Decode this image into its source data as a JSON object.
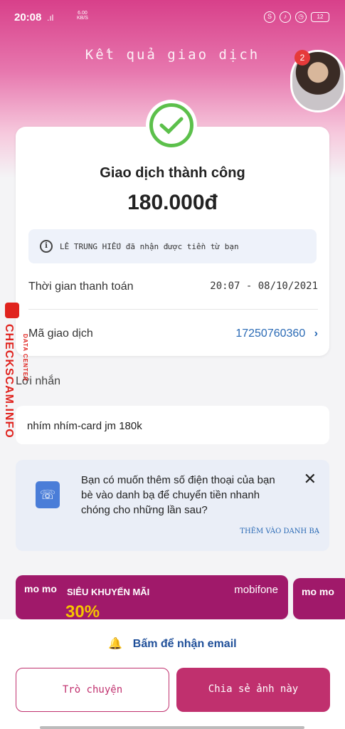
{
  "status": {
    "time": "20:08",
    "signal": ".ıl",
    "speed_top": "6.00",
    "speed_bottom": "KB/S",
    "battery": "12"
  },
  "header": {
    "title": "Kết quả giao dịch",
    "notification_count": "2"
  },
  "result": {
    "status_text": "Giao dịch thành công",
    "amount": "180.000đ",
    "info": "LÊ TRUNG HIẾU đã nhận được tiền từ bạn",
    "time_label": "Thời gian thanh toán",
    "time_value": "20:07 - 08/10/2021",
    "id_label": "Mã giao dịch",
    "id_value": "17250760360"
  },
  "message": {
    "label": "Lời nhắn",
    "text": "nhím nhím-card jm 180k"
  },
  "suggest": {
    "text": "Bạn có muốn thêm số điện thoại của bạn bè vào danh bạ để chuyển tiền nhanh chóng cho những lần sau?",
    "link": "THÊM VÀO DANH BẠ",
    "close": "✕"
  },
  "banner": {
    "brand": "mo mo",
    "promo_title": "SIÊU KHUYẾN MÃI",
    "partner": "mobifone",
    "promo_big": "30%"
  },
  "actions": {
    "email": "Bấm để nhận email",
    "chat": "Trò chuyện",
    "share": "Chia sẻ ảnh này"
  },
  "watermark": {
    "main": "CHECKSCAM.INFO",
    "sub": "DATA CENTER"
  }
}
